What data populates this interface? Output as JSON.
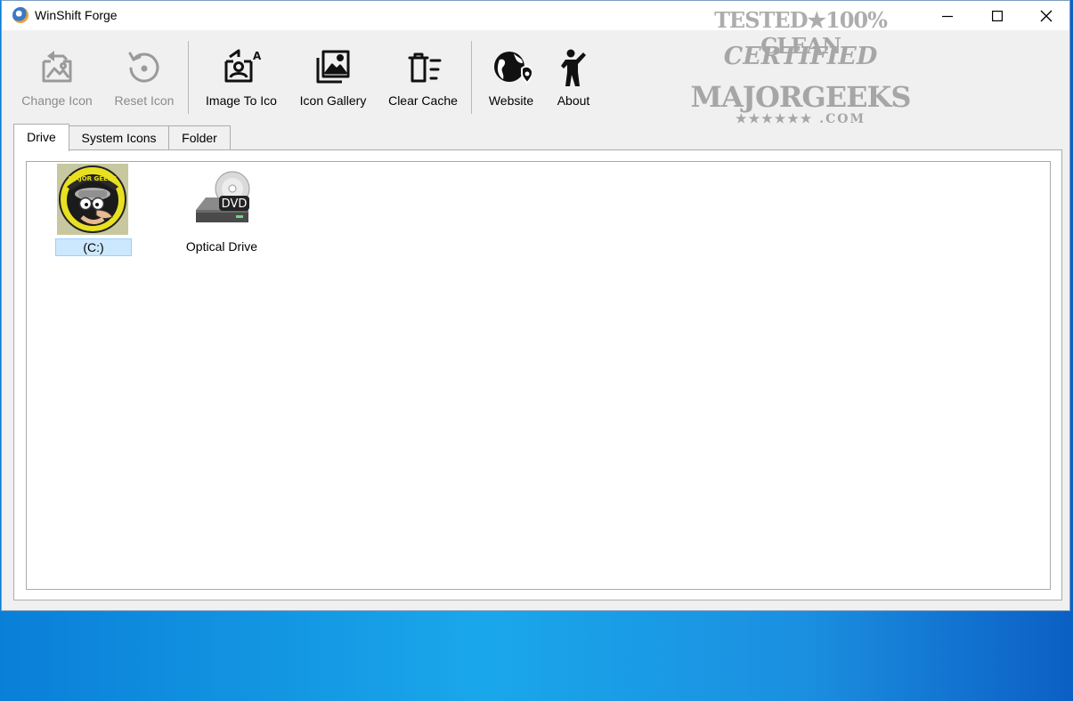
{
  "window": {
    "title": "WinShift Forge",
    "icons": {
      "app": "winshift-app-icon",
      "minimize": "minimize-icon",
      "maximize": "maximize-icon",
      "close": "close-icon"
    }
  },
  "toolbar": {
    "buttons": [
      {
        "label": "Change Icon",
        "icon": "change-icon-icon",
        "enabled": false
      },
      {
        "label": "Reset Icon",
        "icon": "reset-icon-icon",
        "enabled": false
      },
      {
        "label": "Image To Ico",
        "icon": "image-to-ico-icon",
        "enabled": true
      },
      {
        "label": "Icon Gallery",
        "icon": "icon-gallery-icon",
        "enabled": true
      },
      {
        "label": "Clear Cache",
        "icon": "clear-cache-icon",
        "enabled": true
      },
      {
        "label": "Website",
        "icon": "website-globe-icon",
        "enabled": true
      },
      {
        "label": "About",
        "icon": "about-person-icon",
        "enabled": true
      }
    ]
  },
  "tabs": [
    {
      "label": "Drive",
      "active": true
    },
    {
      "label": "System Icons",
      "active": false
    },
    {
      "label": "Folder",
      "active": false
    }
  ],
  "drive_list": {
    "items": [
      {
        "label": "(C:)",
        "icon": "majorgeeks-drive-icon",
        "selected": true
      },
      {
        "label": "Optical Drive",
        "icon": "dvd-drive-icon",
        "badge": "DVD",
        "selected": false
      }
    ]
  },
  "watermark": {
    "line1": "TESTED★100% CLEAN",
    "line2": "CERTIFIED",
    "line3": "MAJORGEEKS",
    "line4": "★★★★★★ .COM"
  },
  "colors": {
    "window_bg": "#f0f0f0",
    "selection_bg": "#cce8ff",
    "disabled_text": "#8a8a8a",
    "desktop_blue": "#1aa7ea"
  }
}
